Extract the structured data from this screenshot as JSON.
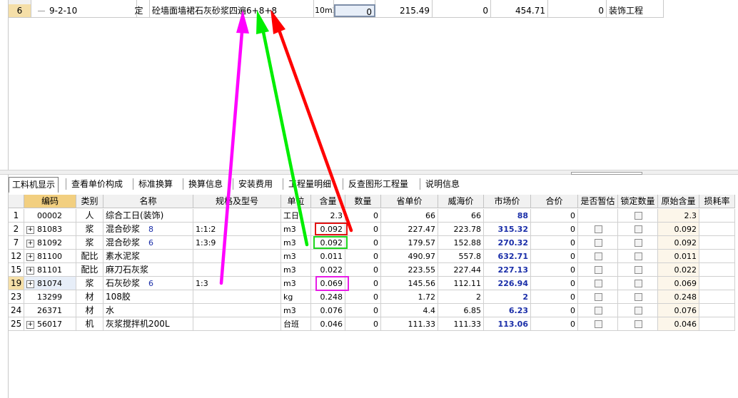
{
  "top_table": {
    "row": {
      "num": "6",
      "code": "9-2-10",
      "type": "定",
      "name": "砼墙面墙裙石灰砂浆四遍6+8+8",
      "unit": "10m2",
      "qty": "0",
      "price": "215.49",
      "c1": "0",
      "c2": "454.71",
      "c3": "0",
      "category": "装饰工程"
    }
  },
  "tabs": [
    "工料机显示",
    "查看单价构成",
    "标准换算",
    "换算信息",
    "安装费用",
    "工程量明细",
    "反查图形工程量",
    "说明信息"
  ],
  "columns": [
    "编码",
    "类别",
    "名称",
    "规格及型号",
    "单位",
    "含量",
    "数量",
    "省单价",
    "威海价",
    "市场价",
    "合价",
    "是否暂估",
    "锁定数量",
    "原始含量",
    "损耗率"
  ],
  "rows": [
    {
      "n": "1",
      "expand": false,
      "code": "00002",
      "type": "人",
      "name": "综合工日(装饰)",
      "extra": "",
      "spec": "",
      "unit": "工日",
      "content": "2.3",
      "qty": "0",
      "prov": "66",
      "wh": "66",
      "market": "88",
      "total": "0",
      "est": false,
      "lock": true,
      "orig": "2.3"
    },
    {
      "n": "2",
      "expand": true,
      "code": "81083",
      "type": "浆",
      "name": "混合砂浆",
      "extra": "8",
      "spec": "1:1:2",
      "unit": "m3",
      "content": "0.092",
      "qty": "0",
      "prov": "227.47",
      "wh": "223.78",
      "market": "315.32",
      "total": "0",
      "est": true,
      "lock": true,
      "orig": "0.092"
    },
    {
      "n": "7",
      "expand": true,
      "code": "81092",
      "type": "浆",
      "name": "混合砂浆",
      "extra": "6",
      "spec": "1:3:9",
      "unit": "m3",
      "content": "0.092",
      "qty": "0",
      "prov": "179.57",
      "wh": "152.88",
      "market": "270.32",
      "total": "0",
      "est": true,
      "lock": true,
      "orig": "0.092"
    },
    {
      "n": "12",
      "expand": true,
      "code": "81100",
      "type": "配比",
      "name": "素水泥浆",
      "extra": "",
      "spec": "",
      "unit": "m3",
      "content": "0.011",
      "qty": "0",
      "prov": "490.97",
      "wh": "557.8",
      "market": "632.71",
      "total": "0",
      "est": true,
      "lock": true,
      "orig": "0.011"
    },
    {
      "n": "15",
      "expand": true,
      "code": "81101",
      "type": "配比",
      "name": "麻刀石灰浆",
      "extra": "",
      "spec": "",
      "unit": "m3",
      "content": "0.022",
      "qty": "0",
      "prov": "223.55",
      "wh": "227.44",
      "market": "227.13",
      "total": "0",
      "est": true,
      "lock": true,
      "orig": "0.022"
    },
    {
      "n": "19",
      "expand": true,
      "code": "81074",
      "type": "浆",
      "name": "石灰砂浆",
      "extra": "6",
      "spec": "1:3",
      "unit": "m3",
      "content": "0.069",
      "qty": "0",
      "prov": "145.56",
      "wh": "112.11",
      "market": "226.94",
      "total": "0",
      "est": true,
      "lock": true,
      "orig": "0.069"
    },
    {
      "n": "23",
      "expand": false,
      "code": "13299",
      "type": "材",
      "name": "108胶",
      "extra": "",
      "spec": "",
      "unit": "kg",
      "content": "0.248",
      "qty": "0",
      "prov": "1.72",
      "wh": "2",
      "market": "2",
      "total": "0",
      "est": true,
      "lock": true,
      "orig": "0.248"
    },
    {
      "n": "24",
      "expand": false,
      "code": "26371",
      "type": "材",
      "name": "水",
      "extra": "",
      "spec": "",
      "unit": "m3",
      "content": "0.076",
      "qty": "0",
      "prov": "4.4",
      "wh": "6.85",
      "market": "6.23",
      "total": "0",
      "est": true,
      "lock": true,
      "orig": "0.076"
    },
    {
      "n": "25",
      "expand": true,
      "code": "56017",
      "type": "机",
      "name": "灰浆搅拌机200L",
      "extra": "",
      "spec": "",
      "unit": "台班",
      "content": "0.046",
      "qty": "0",
      "prov": "111.33",
      "wh": "111.33",
      "market": "113.06",
      "total": "0",
      "est": true,
      "lock": true,
      "orig": "0.046"
    }
  ],
  "colors": {
    "arrow_magenta": "#ff00ff",
    "arrow_green": "#00ee00",
    "arrow_red": "#ff0000",
    "header_highlight": "#f2cf80",
    "market_text": "#1a2ea8"
  }
}
